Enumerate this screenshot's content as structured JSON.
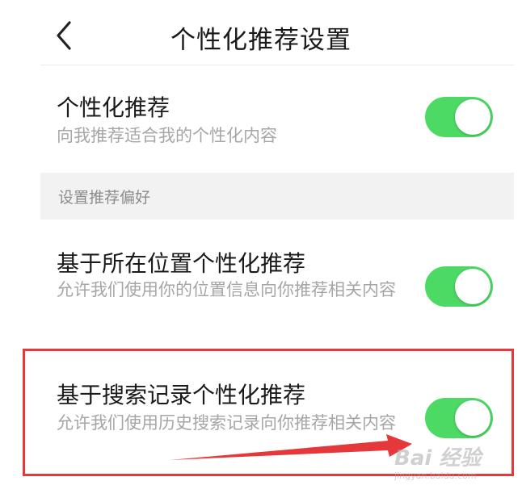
{
  "header": {
    "title": "个性化推荐设置"
  },
  "rows": [
    {
      "title": "个性化推荐",
      "desc": "向我推荐适合我的个性化内容",
      "enabled": true
    },
    {
      "title": "基于所在位置个性化推荐",
      "desc": "允许我们使用你的位置信息向你推荐相关内容",
      "enabled": true
    },
    {
      "title": "基于搜索记录个性化推荐",
      "desc": "允许我们使用历史搜索记录向你推荐相关内容",
      "enabled": true
    }
  ],
  "section": {
    "label": "设置推荐偏好"
  },
  "icons": {
    "back": "chevron-left-icon",
    "arrow": "red-arrow-annotation"
  },
  "colors": {
    "toggle_on": "#4cd964",
    "highlight": "#e5383b",
    "section_bg": "#f2f2f2"
  },
  "watermark": {
    "main": "Bai 经验",
    "sub": "jingyan.baidu.com"
  }
}
